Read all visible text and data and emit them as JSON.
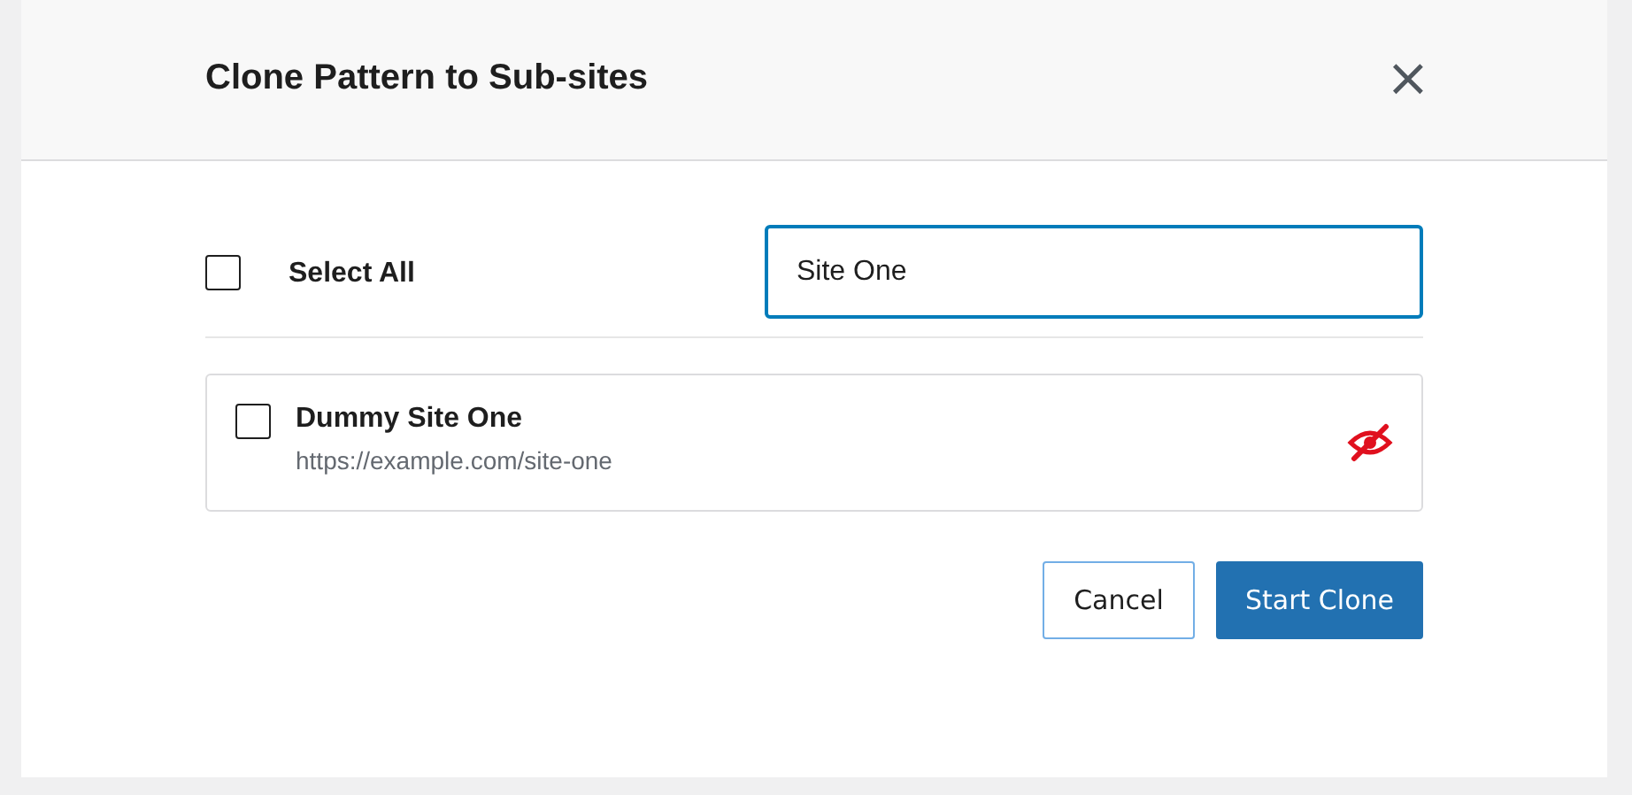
{
  "dialog": {
    "title": "Clone Pattern to Sub-sites",
    "close_icon": "×"
  },
  "select_all": {
    "label": "Select All",
    "checked": false
  },
  "search": {
    "value": "Site One"
  },
  "sites": [
    {
      "name": "Dummy Site One",
      "url": "https://example.com/site-one",
      "checked": false,
      "hidden": true
    }
  ],
  "buttons": [
    {
      "label": "Cancel",
      "kind": "secondary"
    },
    {
      "label": "Start Clone",
      "kind": "primary"
    }
  ]
}
